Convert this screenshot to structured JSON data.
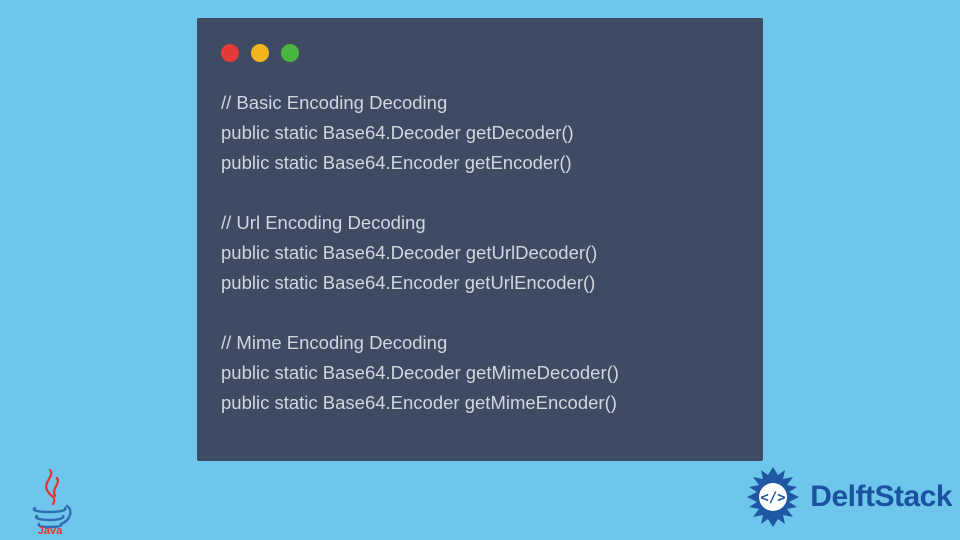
{
  "code": {
    "lines": [
      "// Basic Encoding Decoding",
      "public static Base64.Decoder getDecoder()",
      "public static Base64.Encoder getEncoder()",
      "",
      "// Url Encoding Decoding",
      "public static Base64.Decoder getUrlDecoder()",
      "public static Base64.Encoder getUrlEncoder()",
      "",
      "// Mime Encoding Decoding",
      "public static Base64.Decoder getMimeDecoder()",
      "public static Base64.Encoder getMimeEncoder()"
    ]
  },
  "logos": {
    "java_label": "Java",
    "delft_label": "DelftStack"
  },
  "colors": {
    "page_bg": "#6fc6ec",
    "window_bg": "#3f4a63",
    "code_fg": "#d2d6de",
    "traffic_red": "#e43b3a",
    "traffic_yellow": "#f3b51e",
    "traffic_green": "#4ab53f",
    "java_red": "#e8312e",
    "java_blue": "#2f6db1",
    "delft_blue": "#19529e"
  }
}
